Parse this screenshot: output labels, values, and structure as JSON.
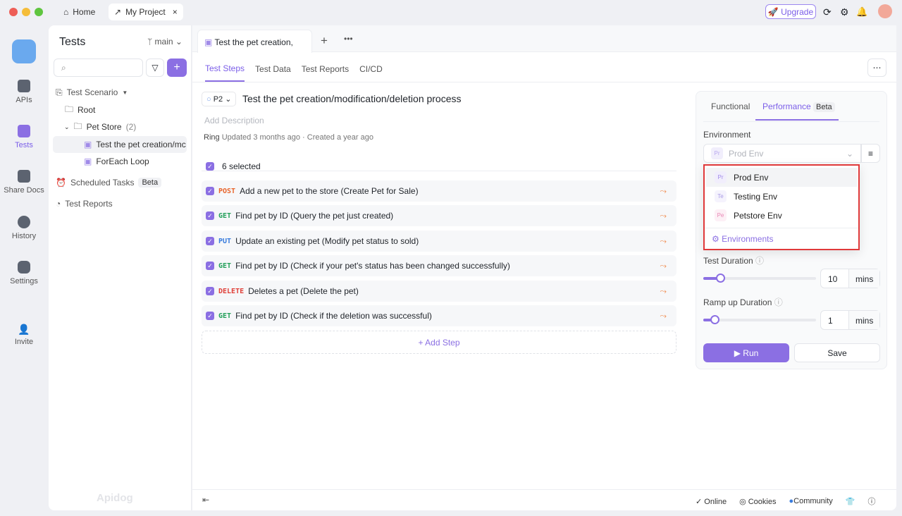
{
  "titlebar": {
    "tabs": [
      {
        "label": "Home",
        "icon": "home-icon"
      },
      {
        "label": "My Project",
        "icon": "external-link-icon"
      }
    ],
    "upgrade": "Upgrade"
  },
  "rail": {
    "items": [
      {
        "label": "APIs"
      },
      {
        "label": "Tests"
      },
      {
        "label": "Share Docs"
      },
      {
        "label": "History"
      },
      {
        "label": "Settings"
      },
      {
        "label": "Invite"
      }
    ]
  },
  "sidebar": {
    "title": "Tests",
    "branch": "main",
    "search_placeholder": "",
    "tree": {
      "scenario": "Test Scenario",
      "root": "Root",
      "folder": "Pet Store",
      "folder_count": "(2)",
      "items": [
        "Test the pet creation/mc",
        "ForEach Loop"
      ],
      "scheduled": "Scheduled Tasks",
      "scheduled_badge": "Beta",
      "reports": "Test Reports"
    },
    "watermark": "Apidog"
  },
  "editor": {
    "tab_title": "Test the pet creation,",
    "subtabs": [
      "Test Steps",
      "Test Data",
      "Test Reports",
      "CI/CD"
    ],
    "priority": "P2",
    "title": "Test the pet creation/modification/deletion process",
    "description_placeholder": "Add Description",
    "owner": "Ring",
    "meta": "Updated 3 months ago · Created a year ago",
    "selected": "6 selected",
    "steps": [
      {
        "method": "POST",
        "color": "#e8652c",
        "text": "Add a new pet to the store (Create Pet for Sale)"
      },
      {
        "method": "GET",
        "color": "#24a05a",
        "text": "Find pet by ID (Query the pet just created)"
      },
      {
        "method": "PUT",
        "color": "#3b7ddd",
        "text": "Update an existing pet (Modify pet status to sold)"
      },
      {
        "method": "GET",
        "color": "#24a05a",
        "text": "Find pet by ID (Check if your pet's status has been changed successfully)"
      },
      {
        "method": "DELETE",
        "color": "#e0413a",
        "text": "Deletes a pet (Delete the pet)"
      },
      {
        "method": "GET",
        "color": "#24a05a",
        "text": "Find pet by ID (Check if the deletion was successful)"
      }
    ],
    "add_step": "+ Add Step"
  },
  "run_panel": {
    "tabs": [
      "Functional",
      "Performance"
    ],
    "beta": "Beta",
    "env_label": "Environment",
    "env_value": "Prod Env",
    "env_abbr": "Pr",
    "options": [
      {
        "abbr": "Pr",
        "label": "Prod Env",
        "color": "#a08ae8",
        "bg": "#f1eefc"
      },
      {
        "abbr": "Te",
        "label": "Testing Env",
        "color": "#a99be6",
        "bg": "#f5f3fd"
      },
      {
        "abbr": "Pe",
        "label": "Petstore Env",
        "color": "#e887b5",
        "bg": "#fdf0f6"
      }
    ],
    "manage": "Environments",
    "duration_label": "Test Duration",
    "duration": "10",
    "ramp_label": "Ramp up Duration",
    "ramp": "1",
    "unit": "mins",
    "run": "Run",
    "save": "Save",
    "accent": "#8b6fe3"
  },
  "footer": {
    "online": "Online",
    "cookies": "Cookies",
    "community": "Community"
  }
}
